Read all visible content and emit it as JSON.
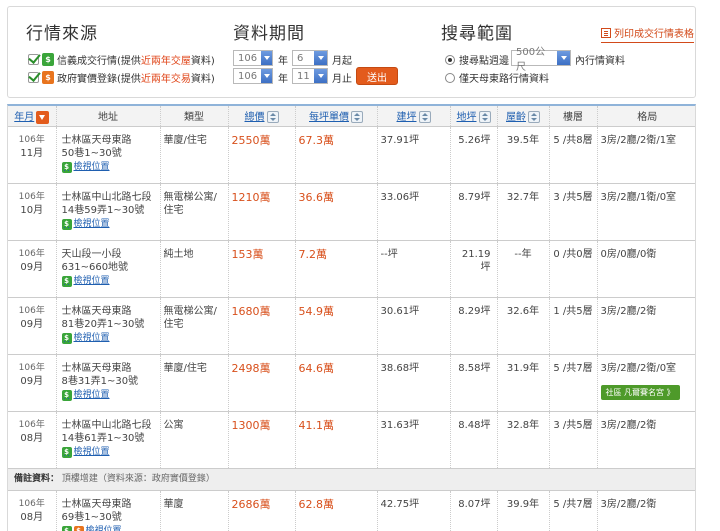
{
  "filters": {
    "source_title": "行情來源",
    "source_options": [
      {
        "badge": "$",
        "text_a": "信義成交行情(提供",
        "text_hl": "近兩年交屋",
        "text_b": "資料)",
        "checked": true
      },
      {
        "badge": "$",
        "text_a": "政府實價登錄(提供",
        "text_hl": "近兩年交易",
        "text_b": "資料)",
        "checked": true
      }
    ],
    "period_title": "資料期間",
    "period_from": {
      "year": "106",
      "year_unit": "年",
      "month": "6",
      "month_unit": "月起"
    },
    "period_to": {
      "year": "106",
      "year_unit": "年",
      "month": "11",
      "month_unit": "月止"
    },
    "submit_label": "送出",
    "range_title": "搜尋範圍",
    "range_options": [
      {
        "label": "搜尋點週邊",
        "select": "500公尺",
        "suffix": "內行情資料",
        "selected": true
      },
      {
        "label": "僅天母東路行情資料",
        "selected": false
      }
    ],
    "print_label": "列印成交行情表格"
  },
  "table": {
    "headers": [
      "年月",
      "地址",
      "類型",
      "總價",
      "每坪單價",
      "建坪",
      "地坪",
      "屋齡",
      "樓層",
      "格局"
    ],
    "map_label": "檢視位置",
    "note_label": "備註資料：",
    "note_text": "頂樓增建（資料來源：政府實價登錄）",
    "rows": [
      {
        "year": "106年",
        "month": "11月",
        "addr1": "士林區天母東路",
        "addr2": "50巷1~30號",
        "badges": [
          "$"
        ],
        "type": "華廈/住宅",
        "total": "2550萬",
        "unit": "67.3萬",
        "build": "37.91坪",
        "land": "5.26坪",
        "age": "39.5年",
        "floor": "5 /共8層",
        "layout": "3房/2廳/2衛/1室",
        "ad": ""
      },
      {
        "year": "106年",
        "month": "10月",
        "addr1": "士林區中山北路七段",
        "addr2": "14巷59弄1~30號",
        "badges": [
          "$"
        ],
        "type": "無電梯公寓/住宅",
        "total": "1210萬",
        "unit": "36.6萬",
        "build": "33.06坪",
        "land": "8.79坪",
        "age": "32.7年",
        "floor": "3 /共5層",
        "layout": "3房/2廳/1衛/0室",
        "ad": ""
      },
      {
        "year": "106年",
        "month": "09月",
        "addr1": "天山段一小段",
        "addr2": "631~660地號",
        "badges": [
          "$"
        ],
        "type": "純土地",
        "total": "153萬",
        "unit": "7.2萬",
        "build": "--坪",
        "land": "21.19坪",
        "age": "--年",
        "floor": "0 /共0層",
        "layout": "0房/0廳/0衛",
        "ad": ""
      },
      {
        "year": "106年",
        "month": "09月",
        "addr1": "士林區天母東路",
        "addr2": "81巷20弄1~30號",
        "badges": [
          "$"
        ],
        "type": "無電梯公寓/住宅",
        "total": "1680萬",
        "unit": "54.9萬",
        "build": "30.61坪",
        "land": "8.29坪",
        "age": "32.6年",
        "floor": "1 /共5層",
        "layout": "3房/2廳/2衛",
        "ad": ""
      },
      {
        "year": "106年",
        "month": "09月",
        "addr1": "士林區天母東路",
        "addr2": "8巷31弄1~30號",
        "badges": [
          "$"
        ],
        "type": "華廈/住宅",
        "total": "2498萬",
        "unit": "64.6萬",
        "build": "38.68坪",
        "land": "8.58坪",
        "age": "31.9年",
        "floor": "5 /共7層",
        "layout": "3房/2廳/2衛/0室",
        "ad": "社區 凡爾賽名宮 》"
      },
      {
        "year": "106年",
        "month": "08月",
        "addr1": "士林區中山北路七段",
        "addr2": "14巷61弄1~30號",
        "badges": [
          "$"
        ],
        "type": "公寓",
        "total": "1300萬",
        "unit": "41.1萬",
        "build": "31.63坪",
        "land": "8.48坪",
        "age": "32.8年",
        "floor": "3 /共5層",
        "layout": "3房/2廳/2衛",
        "ad": ""
      },
      {
        "year": "106年",
        "month": "08月",
        "addr1": "士林區天母東路",
        "addr2": "69巷1~30號",
        "badges": [
          "$",
          "$"
        ],
        "type": "華廈",
        "total": "2686萬",
        "unit": "62.8萬",
        "build": "42.75坪",
        "land": "8.07坪",
        "age": "39.9年",
        "floor": "5 /共7層",
        "layout": "3房/2廳/2衛",
        "ad": ""
      }
    ]
  },
  "colors": {
    "accent": "#e35b1c",
    "price": "#d8501c",
    "link": "#1f5fb0",
    "badge_green": "#3aa53a",
    "badge_orange": "#e8741e"
  }
}
